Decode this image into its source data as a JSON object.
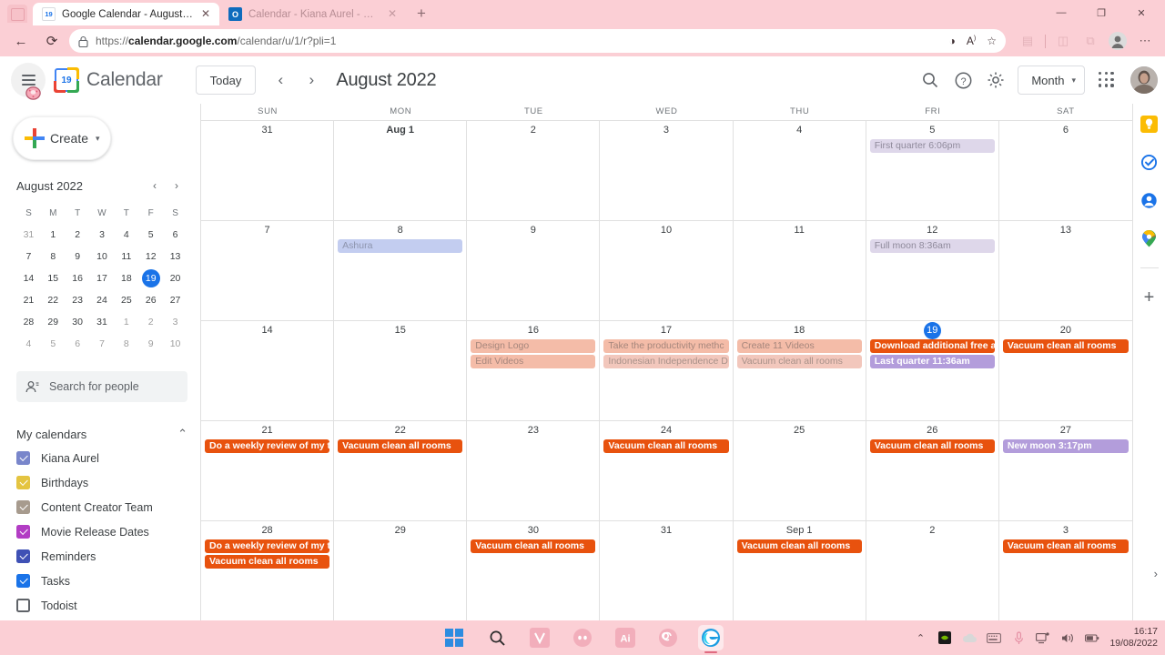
{
  "browser": {
    "tabs": [
      {
        "title": "Google Calendar - August 2022",
        "favicon": "google-calendar-favicon",
        "favicon_text": "19",
        "active": true
      },
      {
        "title": "Calendar - Kiana Aurel - Outlook",
        "favicon": "outlook-favicon",
        "favicon_text": "O",
        "active": false
      }
    ],
    "new_tab_label": "+",
    "window_controls": {
      "minimize": "—",
      "maximize": "❐",
      "close": "✕"
    },
    "url": "https://calendar.google.com/calendar/u/1/r?pli=1",
    "url_bold": "calendar.google.com",
    "url_rest": "/calendar/u/1/r?pli=1",
    "url_scheme": "https://",
    "back_label": "←",
    "refresh_label": "⟳",
    "lock_icon": "lock-icon",
    "split_screen_icon": "split-screen-icon",
    "read_aloud_icon": "read-aloud-icon",
    "favorites_icon": "add-favorite-icon",
    "collections_icon": "collections-icon",
    "profile_icon": "browser-profile-icon",
    "settings_more_icon": "more-options-icon"
  },
  "app": {
    "title": "Calendar",
    "logo_day": "19",
    "today_button": "Today",
    "prev_label": "‹",
    "next_label": "›",
    "current_month": "August 2022",
    "search_icon": "search-icon",
    "help_icon": "help-icon",
    "settings_icon": "gear-icon",
    "view_selected": "Month",
    "view_caret": "▾",
    "apps_icon": "google-apps-grid-icon",
    "avatar": "user-avatar"
  },
  "sidebar": {
    "create_label": "Create",
    "create_caret": "▾",
    "mini_calendar": {
      "title": "August 2022",
      "prev": "‹",
      "next": "›",
      "dow": [
        "S",
        "M",
        "T",
        "W",
        "T",
        "F",
        "S"
      ],
      "weeks": [
        [
          {
            "d": "31",
            "out": true
          },
          {
            "d": "1"
          },
          {
            "d": "2"
          },
          {
            "d": "3"
          },
          {
            "d": "4"
          },
          {
            "d": "5"
          },
          {
            "d": "6"
          }
        ],
        [
          {
            "d": "7"
          },
          {
            "d": "8"
          },
          {
            "d": "9"
          },
          {
            "d": "10"
          },
          {
            "d": "11"
          },
          {
            "d": "12"
          },
          {
            "d": "13"
          }
        ],
        [
          {
            "d": "14"
          },
          {
            "d": "15"
          },
          {
            "d": "16"
          },
          {
            "d": "17"
          },
          {
            "d": "18"
          },
          {
            "d": "19",
            "today": true
          },
          {
            "d": "20"
          }
        ],
        [
          {
            "d": "21"
          },
          {
            "d": "22"
          },
          {
            "d": "23"
          },
          {
            "d": "24"
          },
          {
            "d": "25"
          },
          {
            "d": "26"
          },
          {
            "d": "27"
          }
        ],
        [
          {
            "d": "28"
          },
          {
            "d": "29"
          },
          {
            "d": "30"
          },
          {
            "d": "31"
          },
          {
            "d": "1",
            "out": true
          },
          {
            "d": "2",
            "out": true
          },
          {
            "d": "3",
            "out": true
          }
        ],
        [
          {
            "d": "4",
            "out": true
          },
          {
            "d": "5",
            "out": true
          },
          {
            "d": "6",
            "out": true
          },
          {
            "d": "7",
            "out": true
          },
          {
            "d": "8",
            "out": true
          },
          {
            "d": "9",
            "out": true
          },
          {
            "d": "10",
            "out": true
          }
        ]
      ]
    },
    "search_people_placeholder": "Search for people",
    "search_people_icon": "people-search-icon",
    "my_calendars_title": "My calendars",
    "my_calendars_collapse": "⌃",
    "calendars": [
      {
        "label": "Kiana Aurel",
        "color": "#7986cb",
        "checked": true
      },
      {
        "label": "Birthdays",
        "color": "#e4c441",
        "checked": true
      },
      {
        "label": "Content Creator Team",
        "color": "#a79b8e",
        "checked": true
      },
      {
        "label": "Movie Release Dates",
        "color": "#b23dc4",
        "checked": true
      },
      {
        "label": "Reminders",
        "color": "#3f51b5",
        "checked": true
      },
      {
        "label": "Tasks",
        "color": "#1a73e8",
        "checked": true
      },
      {
        "label": "Todoist",
        "color": "#ffffff",
        "checked": false
      },
      {
        "label": "Todoist",
        "color": "#e8520e",
        "checked": true
      }
    ]
  },
  "calendar_grid": {
    "dow": [
      "SUN",
      "MON",
      "TUE",
      "WED",
      "THU",
      "FRI",
      "SAT"
    ],
    "weeks": [
      [
        {
          "num": "31",
          "events": []
        },
        {
          "num": "Aug 1",
          "bold": true,
          "events": []
        },
        {
          "num": "2",
          "events": []
        },
        {
          "num": "3",
          "events": []
        },
        {
          "num": "4",
          "events": []
        },
        {
          "num": "5",
          "events": [
            {
              "title": "First quarter 6:06pm",
              "bg": "#ded7ea",
              "fg": "#8f8a9b",
              "pale": true
            }
          ]
        },
        {
          "num": "6",
          "events": []
        }
      ],
      [
        {
          "num": "7",
          "events": []
        },
        {
          "num": "8",
          "events": [
            {
              "title": "Ashura",
              "bg": "#c3cdf0",
              "fg": "#8e95ae",
              "pale": true
            }
          ]
        },
        {
          "num": "9",
          "events": []
        },
        {
          "num": "10",
          "events": []
        },
        {
          "num": "11",
          "events": []
        },
        {
          "num": "12",
          "events": [
            {
              "title": "Full moon 8:36am",
              "bg": "#ded7ea",
              "fg": "#8f8a9b",
              "pale": true
            }
          ]
        },
        {
          "num": "13",
          "events": []
        }
      ],
      [
        {
          "num": "14",
          "events": []
        },
        {
          "num": "15",
          "events": []
        },
        {
          "num": "16",
          "events": [
            {
              "title": "Design Logo",
              "bg": "#f4bca8",
              "fg": "#a5867c",
              "pale": true
            },
            {
              "title": "Edit Videos",
              "bg": "#f4bca8",
              "fg": "#a5867c",
              "pale": true
            }
          ]
        },
        {
          "num": "17",
          "events": [
            {
              "title": "Take the productivity methc",
              "bg": "#f4bca8",
              "fg": "#a5867c",
              "pale": true
            },
            {
              "title": "Indonesian Independence D",
              "bg": "#f2c7bc",
              "fg": "#a89189",
              "pale": true
            }
          ]
        },
        {
          "num": "18",
          "events": [
            {
              "title": "Create 11 Videos",
              "bg": "#f4bca8",
              "fg": "#a5867c",
              "pale": true
            },
            {
              "title": "Vacuum clean all rooms",
              "bg": "#f2c7bc",
              "fg": "#a89189",
              "pale": true
            }
          ]
        },
        {
          "num": "19",
          "today": true,
          "events": [
            {
              "title": "Download additional free ap",
              "bg": "#e8520e",
              "fg": "#ffffff"
            },
            {
              "title": "Last quarter 11:36am",
              "bg": "#b39ddb",
              "fg": "#ffffff"
            }
          ]
        },
        {
          "num": "20",
          "events": [
            {
              "title": "Vacuum clean all rooms",
              "bg": "#e8520e",
              "fg": "#ffffff"
            }
          ]
        }
      ],
      [
        {
          "num": "21",
          "events": [
            {
              "title": "Do a weekly review of my ta",
              "bg": "#e8520e",
              "fg": "#ffffff"
            }
          ]
        },
        {
          "num": "22",
          "events": [
            {
              "title": "Vacuum clean all rooms",
              "bg": "#e8520e",
              "fg": "#ffffff"
            }
          ]
        },
        {
          "num": "23",
          "events": []
        },
        {
          "num": "24",
          "events": [
            {
              "title": "Vacuum clean all rooms",
              "bg": "#e8520e",
              "fg": "#ffffff"
            }
          ]
        },
        {
          "num": "25",
          "events": []
        },
        {
          "num": "26",
          "events": [
            {
              "title": "Vacuum clean all rooms",
              "bg": "#e8520e",
              "fg": "#ffffff"
            }
          ]
        },
        {
          "num": "27",
          "events": [
            {
              "title": "New moon 3:17pm",
              "bg": "#b39ddb",
              "fg": "#ffffff"
            }
          ]
        }
      ],
      [
        {
          "num": "28",
          "events": [
            {
              "title": "Do a weekly review of my ta",
              "bg": "#e8520e",
              "fg": "#ffffff"
            },
            {
              "title": "Vacuum clean all rooms",
              "bg": "#e8520e",
              "fg": "#ffffff"
            }
          ]
        },
        {
          "num": "29",
          "events": []
        },
        {
          "num": "30",
          "events": [
            {
              "title": "Vacuum clean all rooms",
              "bg": "#e8520e",
              "fg": "#ffffff"
            }
          ]
        },
        {
          "num": "31",
          "events": []
        },
        {
          "num": "Sep 1",
          "events": [
            {
              "title": "Vacuum clean all rooms",
              "bg": "#e8520e",
              "fg": "#ffffff"
            }
          ]
        },
        {
          "num": "2",
          "events": []
        },
        {
          "num": "3",
          "events": [
            {
              "title": "Vacuum clean all rooms",
              "bg": "#e8520e",
              "fg": "#ffffff"
            }
          ]
        }
      ]
    ]
  },
  "right_rail": {
    "items": [
      {
        "icon": "google-keep-icon"
      },
      {
        "icon": "google-tasks-icon"
      },
      {
        "icon": "google-contacts-icon"
      },
      {
        "icon": "google-maps-icon"
      }
    ],
    "add_label": "+",
    "expand_label": "›"
  },
  "taskbar": {
    "apps": [
      {
        "name": "windows-start-icon"
      },
      {
        "name": "search-icon"
      },
      {
        "name": "vegas-pro-icon"
      },
      {
        "name": "discord-icon"
      },
      {
        "name": "adobe-illustrator-icon",
        "label": "Ai"
      },
      {
        "name": "obs-studio-icon"
      },
      {
        "name": "microsoft-edge-icon",
        "active": true
      }
    ],
    "tray": {
      "overflow": "⌃",
      "icons": [
        "nvidia-tray-icon",
        "onedrive-tray-icon",
        "keyboard-tray-icon",
        "microphone-tray-icon",
        "network-tray-icon",
        "volume-tray-icon",
        "battery-tray-icon"
      ],
      "time": "16:17",
      "date": "19/08/2022"
    }
  }
}
